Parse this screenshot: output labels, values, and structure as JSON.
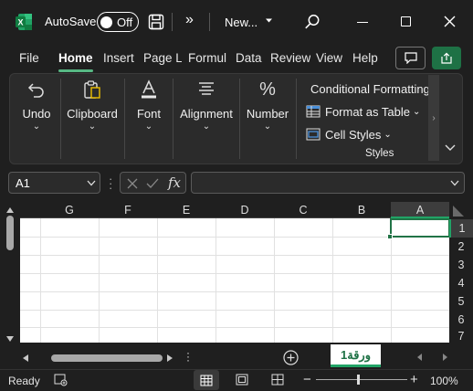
{
  "titlebar": {
    "autosave_label": "AutoSave",
    "autosave_state": "Off",
    "overflow_glyph": "»",
    "doc_title": "New...",
    "app_icon": "excel-icon"
  },
  "tabs": [
    "File",
    "Home",
    "Insert",
    "Page La",
    "Formul",
    "Data",
    "Review",
    "View",
    "Help"
  ],
  "ribbon": {
    "undo": "Undo",
    "clipboard": "Clipboard",
    "font": "Font",
    "alignment": "Alignment",
    "number": "Number",
    "conditional_formatting": "Conditional Formatting",
    "format_as_table": "Format as Table",
    "cell_styles": "Cell Styles",
    "styles_group": "Styles"
  },
  "formula_bar": {
    "name_box": "A1",
    "fx": "fx",
    "value": ""
  },
  "grid": {
    "columns": [
      "G",
      "F",
      "E",
      "D",
      "C",
      "B",
      "A"
    ],
    "rows": [
      "1",
      "2",
      "3",
      "4",
      "5",
      "6",
      "7"
    ],
    "selected_cell": "A1"
  },
  "sheet_tab": {
    "name": "ورقة1"
  },
  "status": {
    "ready": "Ready",
    "zoom": "100%"
  },
  "colors": {
    "accent_green": "#1e7145",
    "selection": "#217346",
    "background": "#1f1f1f",
    "ribbon": "#2b2b2b"
  }
}
